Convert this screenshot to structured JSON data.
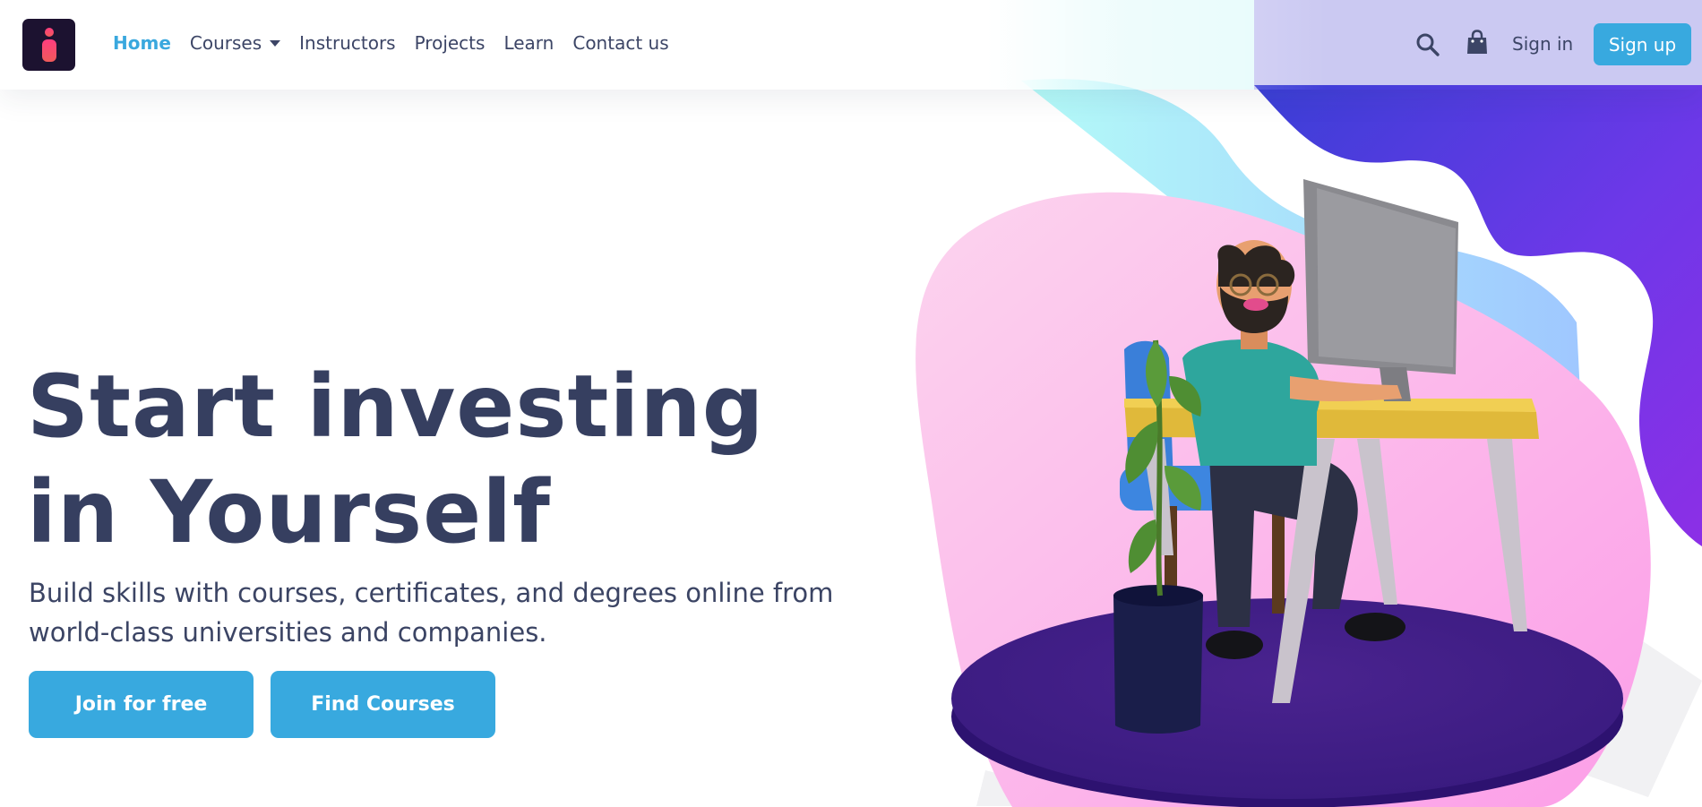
{
  "brand": {
    "logo_icon": "i-logo-icon",
    "colors": {
      "logo_bg": "#1c1230",
      "accent": "#38a9df",
      "text_dark": "#363f60"
    }
  },
  "nav": {
    "links": [
      {
        "label": "Home",
        "active": true
      },
      {
        "label": "Courses",
        "has_dropdown": true
      },
      {
        "label": "Instructors"
      },
      {
        "label": "Projects"
      },
      {
        "label": "Learn"
      },
      {
        "label": "Contact us"
      }
    ],
    "search_icon": "search-icon",
    "cart_icon": "shopping-bag-icon",
    "signin_label": "Sign in",
    "signup_label": "Sign up"
  },
  "hero": {
    "title_line1": "Start investing",
    "title_line2": "in Yourself",
    "subtitle_line1": "Build skills with courses, certificates, and degrees online from",
    "subtitle_line2": "world-class universities and companies.",
    "primary_button": "Join for free",
    "secondary_button": "Find Courses",
    "illustration": "person-at-desk-illustration"
  }
}
